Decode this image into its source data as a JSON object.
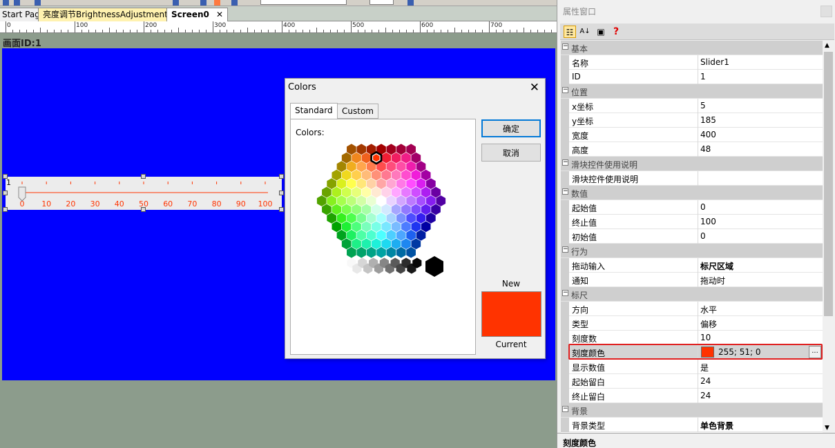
{
  "tabs": [
    {
      "label": "Start Page"
    },
    {
      "label": "亮度调节BrightnessAdjustment"
    },
    {
      "label": "Screen0",
      "close": "✕"
    }
  ],
  "ruler": {
    "labels": [
      "0",
      "100",
      "200",
      "300",
      "400",
      "500",
      "600",
      "700"
    ]
  },
  "canvas": {
    "screen_id": "画面ID:1",
    "background": "#0000ff"
  },
  "slider": {
    "corner_label": "1",
    "start": 0,
    "end": 100,
    "ticks": 10,
    "tick_labels": [
      "0",
      "10",
      "20",
      "30",
      "40",
      "50",
      "60",
      "70",
      "80",
      "90",
      "100"
    ],
    "tick_color": "#ff3300",
    "value": 0
  },
  "colors_dialog": {
    "title": "Colors",
    "close": "✕",
    "tabs": [
      {
        "label": "Standard",
        "active": true
      },
      {
        "label": "Custom",
        "active": false
      }
    ],
    "colors_label": "Colors:",
    "ok": "确定",
    "cancel": "取消",
    "new_label": "New",
    "current_label": "Current",
    "new_color": "#ff3300"
  },
  "properties": {
    "title": "属性窗口",
    "toolbar_icons": [
      "categorized-icon",
      "alphabetical-icon",
      "property-pages-icon",
      "help-icon"
    ],
    "rows": [
      {
        "type": "category",
        "label": "基本"
      },
      {
        "type": "prop",
        "name": "名称",
        "value": "Slider1"
      },
      {
        "type": "prop",
        "name": "ID",
        "value": "1"
      },
      {
        "type": "category",
        "label": "位置"
      },
      {
        "type": "prop",
        "name": "x坐标",
        "value": "5"
      },
      {
        "type": "prop",
        "name": "y坐标",
        "value": "185"
      },
      {
        "type": "prop",
        "name": "宽度",
        "value": "400"
      },
      {
        "type": "prop",
        "name": "高度",
        "value": "48"
      },
      {
        "type": "category",
        "label": "滑块控件使用说明"
      },
      {
        "type": "prop",
        "name": "滑块控件使用说明",
        "value": ""
      },
      {
        "type": "category",
        "label": "数值"
      },
      {
        "type": "prop",
        "name": "起始值",
        "value": "0"
      },
      {
        "type": "prop",
        "name": "终止值",
        "value": "100"
      },
      {
        "type": "prop",
        "name": "初始值",
        "value": "0"
      },
      {
        "type": "category",
        "label": "行为"
      },
      {
        "type": "prop",
        "name": "拖动输入",
        "value": "标尺区域",
        "bold": true
      },
      {
        "type": "prop",
        "name": "通知",
        "value": "拖动时"
      },
      {
        "type": "category",
        "label": "标尺"
      },
      {
        "type": "prop",
        "name": "方向",
        "value": "水平"
      },
      {
        "type": "prop",
        "name": "类型",
        "value": "偏移"
      },
      {
        "type": "prop",
        "name": "刻度数",
        "value": "10"
      },
      {
        "type": "color",
        "name": "刻度颜色",
        "value": "255; 51; 0",
        "swatch": "#ff3300",
        "selected": true,
        "ellipsis": "..."
      },
      {
        "type": "prop",
        "name": "显示数值",
        "value": "是"
      },
      {
        "type": "prop",
        "name": "起始留白",
        "value": "24"
      },
      {
        "type": "prop",
        "name": "终止留白",
        "value": "24"
      },
      {
        "type": "category",
        "label": "背景"
      },
      {
        "type": "prop",
        "name": "背景类型",
        "value": "单色背景",
        "bold": true
      }
    ],
    "description_title": "刻度颜色"
  }
}
